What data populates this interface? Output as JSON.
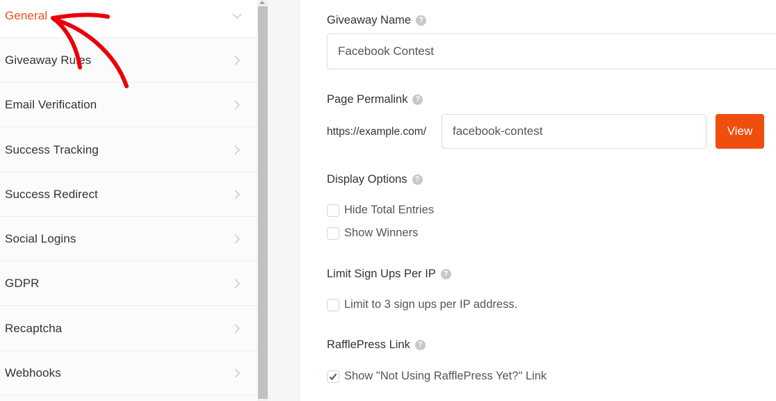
{
  "sidebar": {
    "items": [
      {
        "label": "General",
        "active": true,
        "icon": "chevron-down-icon"
      },
      {
        "label": "Giveaway Rules",
        "active": false,
        "icon": "chevron-right-icon"
      },
      {
        "label": "Email Verification",
        "active": false,
        "icon": "chevron-right-icon"
      },
      {
        "label": "Success Tracking",
        "active": false,
        "icon": "chevron-right-icon"
      },
      {
        "label": "Success Redirect",
        "active": false,
        "icon": "chevron-right-icon"
      },
      {
        "label": "Social Logins",
        "active": false,
        "icon": "chevron-right-icon"
      },
      {
        "label": "GDPR",
        "active": false,
        "icon": "chevron-right-icon"
      },
      {
        "label": "Recaptcha",
        "active": false,
        "icon": "chevron-right-icon"
      },
      {
        "label": "Webhooks",
        "active": false,
        "icon": "chevron-right-icon"
      }
    ]
  },
  "form": {
    "giveaway_name": {
      "label": "Giveaway Name",
      "value": "Facebook Contest",
      "help_icon": "question-circle-icon"
    },
    "permalink": {
      "label": "Page Permalink",
      "prefix": "https://example.com/",
      "value": "facebook-contest",
      "button_label": "View",
      "help_icon": "question-circle-icon"
    },
    "display_options": {
      "label": "Display Options",
      "help_icon": "question-circle-icon",
      "options": [
        {
          "label": "Hide Total Entries",
          "checked": false
        },
        {
          "label": "Show Winners",
          "checked": false
        }
      ]
    },
    "limit_signups": {
      "label": "Limit Sign Ups Per IP",
      "help_icon": "question-circle-icon",
      "option": {
        "label": "Limit to 3 sign ups per IP address.",
        "checked": false
      }
    },
    "rafflepress_link": {
      "label": "RafflePress Link",
      "help_icon": "question-circle-icon",
      "option": {
        "label": "Show \"Not Using RafflePress Yet?\" Link",
        "checked": true
      }
    }
  },
  "annotation": {
    "type": "hand-drawn-arrow",
    "color": "#e8000b",
    "points_to": "General"
  },
  "colors": {
    "accent": "#f04e0f",
    "active_nav": "#e8501b"
  },
  "help_glyph": "?",
  "check_glyph": "✔"
}
